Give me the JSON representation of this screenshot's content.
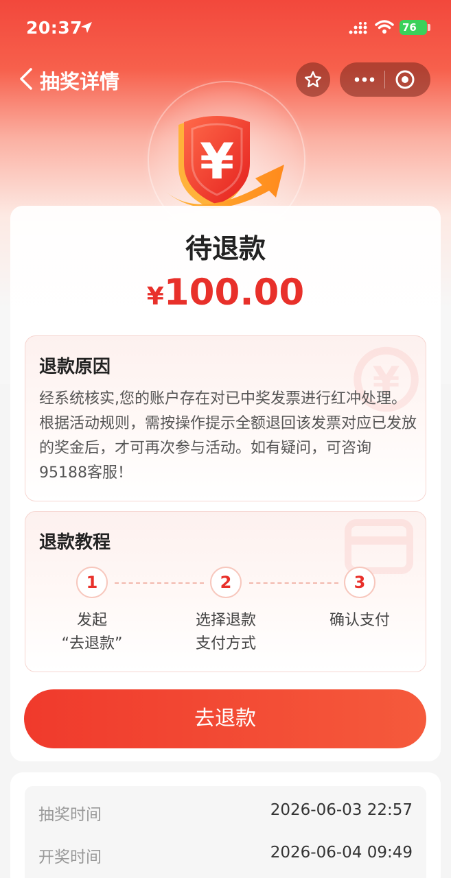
{
  "status_bar": {
    "time": "20:37",
    "battery": "76"
  },
  "nav": {
    "title": "抽奖详情",
    "icons": [
      "back-icon",
      "star-icon",
      "more-icon",
      "target-icon"
    ]
  },
  "header": {
    "status": "待退款",
    "currency": "¥",
    "amount": "100.00"
  },
  "reason": {
    "title": "退款原因",
    "text": "经系统核实,您的账户存在对已中奖发票进行红冲处理。根据活动规则，需按操作提示全额退回该发票对应已发放的奖金后，才可再次参与活动。如有疑问，可咨询95188客服！"
  },
  "tutorial": {
    "title": "退款教程",
    "steps": [
      {
        "num": "1",
        "label_line1": "发起",
        "label_line2": "“去退款”"
      },
      {
        "num": "2",
        "label_line1": "选择退款",
        "label_line2": "支付方式"
      },
      {
        "num": "3",
        "label_line1": "确认支付",
        "label_line2": ""
      }
    ]
  },
  "action": {
    "refund_label": "去退款"
  },
  "info": [
    {
      "label": "抽奖时间",
      "value": "2026-06-03 22:57"
    },
    {
      "label": "开奖时间",
      "value": "2026-06-04 09:49"
    }
  ],
  "colors": {
    "accent": "#e8302a",
    "button": "#f03a2c",
    "header_red": "#f2483c"
  }
}
